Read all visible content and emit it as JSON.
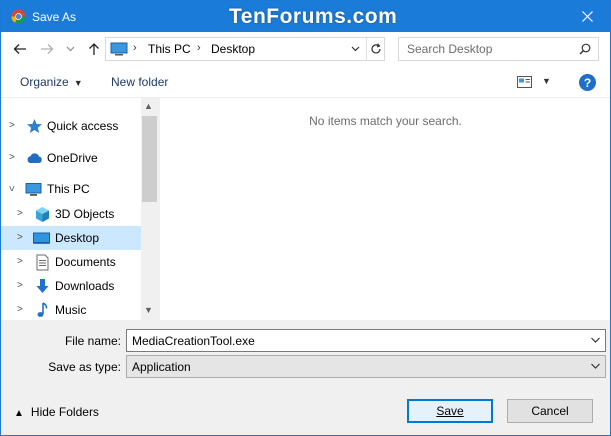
{
  "window": {
    "title": "Save As",
    "watermark": "TenForums.com"
  },
  "address": {
    "crumbs": [
      "This PC",
      "Desktop"
    ]
  },
  "search": {
    "placeholder": "Search Desktop"
  },
  "toolbar": {
    "organize_label": "Organize",
    "new_folder_label": "New folder"
  },
  "nav_tree": {
    "items": [
      {
        "label": "Quick access",
        "icon": "star-icon"
      },
      {
        "label": "OneDrive",
        "icon": "cloud-icon"
      },
      {
        "label": "This PC",
        "icon": "computer-icon"
      },
      {
        "label": "3D Objects",
        "icon": "cube-icon"
      },
      {
        "label": "Desktop",
        "icon": "desktop-icon"
      },
      {
        "label": "Documents",
        "icon": "document-icon"
      },
      {
        "label": "Downloads",
        "icon": "download-icon"
      },
      {
        "label": "Music",
        "icon": "music-icon"
      }
    ]
  },
  "content": {
    "empty_message": "No items match your search."
  },
  "form": {
    "file_name_label": "File name:",
    "file_name_value": "MediaCreationTool.exe",
    "save_type_label": "Save as type:",
    "save_type_value": "Application"
  },
  "footer": {
    "hide_folders_label": "Hide Folders",
    "save_label": "Save",
    "cancel_label": "Cancel"
  },
  "colors": {
    "titlebar": "#1b7bd9",
    "selection": "#cce8ff",
    "accent": "#0078d7"
  }
}
